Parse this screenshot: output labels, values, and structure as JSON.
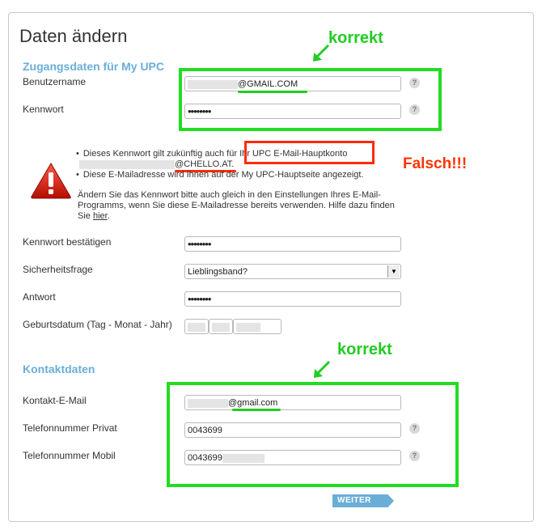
{
  "page": {
    "title": "Daten ändern",
    "section_access": "Zugangsdaten für My UPC",
    "section_contact": "Kontaktdaten",
    "submit_label": "WEITER",
    "help_glyph": "?"
  },
  "access": {
    "username_label": "Benutzername",
    "username_value": "@GMAIL.COM",
    "password_label": "Kennwort",
    "password_value": "••••••••"
  },
  "notice": {
    "line1": "Dieses Kennwort gilt zukünftig auch für Ihr UPC E-Mail-Hauptkonto",
    "line1b": "@CHELLO.AT.",
    "line2": "Diese E-Mailadresse wird Ihnen auf der My UPC-Hauptseite angezeigt.",
    "line3a": "Ändern Sie das Kennwort bitte auch gleich in den Einstellungen Ihres E-Mail-Programms, wenn Sie diese E-Mailadresse bereits verwenden. Hilfe dazu finden Sie ",
    "link": "hier",
    "line3b": "."
  },
  "fields": {
    "confirm_label": "Kennwort bestätigen",
    "confirm_value": "••••••••",
    "question_label": "Sicherheitsfrage",
    "question_value": "Lieblingsband?",
    "answer_label": "Antwort",
    "answer_value": "••••••••",
    "birth_label": "Geburtsdatum (Tag - Monat - Jahr)"
  },
  "contact": {
    "email_label": "Kontakt-E-Mail",
    "email_value": "@gmail.com",
    "phone_private_label": "Telefonnummer Privat",
    "phone_private_value": "0043699",
    "phone_mobile_label": "Telefonnummer Mobil",
    "phone_mobile_value": "0043699"
  },
  "annotations": {
    "korrekt_top": "korrekt",
    "korrekt_bottom": "korrekt",
    "falsch": "Falsch!!!"
  },
  "colors": {
    "section_blue": "#6aaed8",
    "annotation_green": "#22dd22",
    "annotation_red": "#ff2a00"
  }
}
